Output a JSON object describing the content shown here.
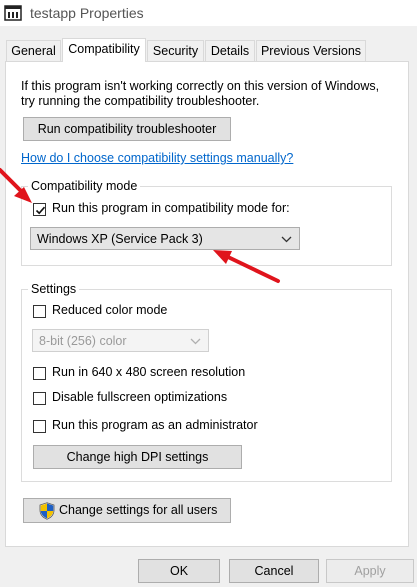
{
  "window": {
    "title": "testapp Properties"
  },
  "tabs": [
    {
      "label": "General"
    },
    {
      "label": "Compatibility"
    },
    {
      "label": "Security"
    },
    {
      "label": "Details"
    },
    {
      "label": "Previous Versions"
    }
  ],
  "intro": {
    "line1": "If this program isn't working correctly on this version of Windows,",
    "line2": "try running the compatibility troubleshooter."
  },
  "troubleshooter_button": "Run compatibility troubleshooter",
  "help_link": "How do I choose compatibility settings manually?",
  "compat_mode": {
    "legend": "Compatibility mode",
    "checkbox_label": "Run this program in compatibility mode for:",
    "checked": true,
    "selected_os": "Windows XP (Service Pack 3)"
  },
  "settings": {
    "legend": "Settings",
    "reduced_color": "Reduced color mode",
    "color_select": "8-bit (256) color",
    "res_640": "Run in 640 x 480 screen resolution",
    "disable_fullscreen": "Disable fullscreen optimizations",
    "run_admin": "Run this program as an administrator",
    "dpi_button": "Change high DPI settings"
  },
  "all_users_button": "Change settings for all users",
  "footer": {
    "ok": "OK",
    "cancel": "Cancel",
    "apply": "Apply"
  },
  "colors": {
    "accent": "#0066cc",
    "annotation": "#e0141c"
  }
}
